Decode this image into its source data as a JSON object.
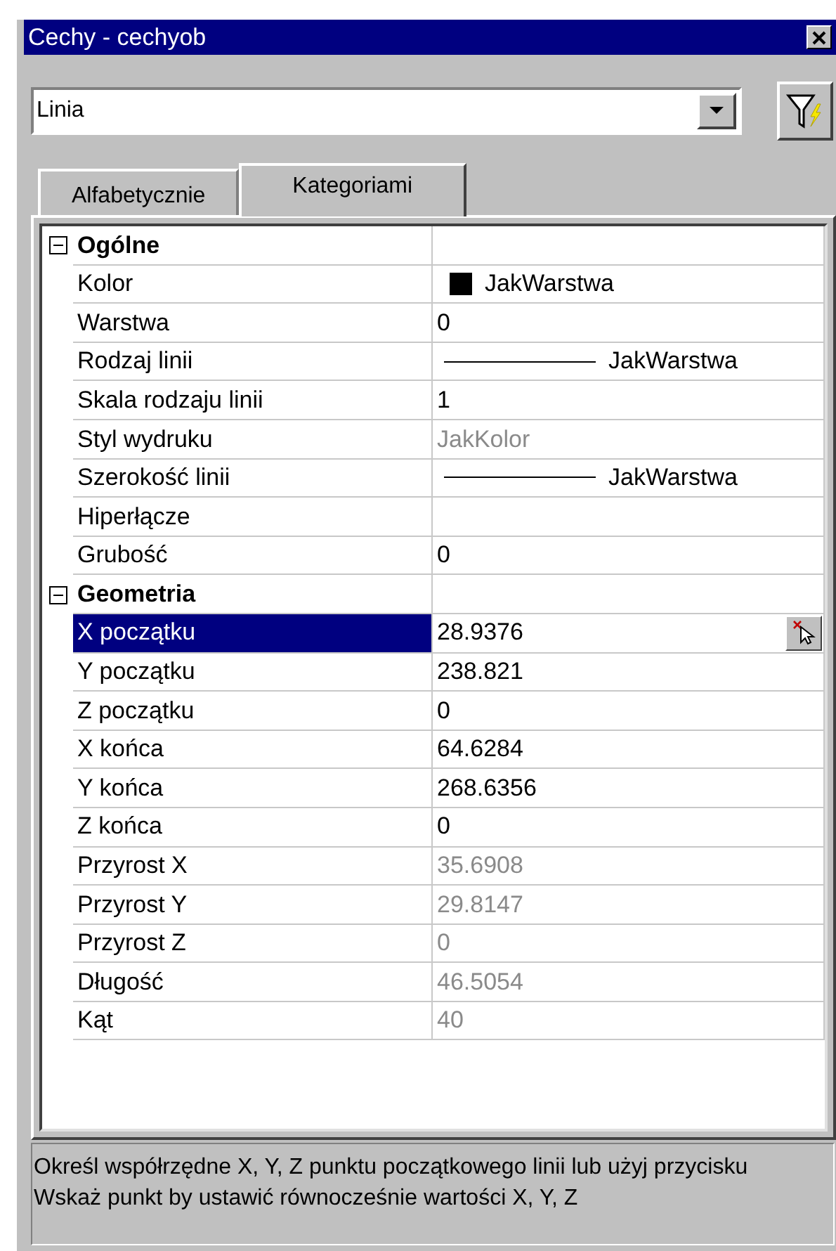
{
  "window": {
    "title": "Cechy - cechyob"
  },
  "object_selector": {
    "value": "Linia"
  },
  "tabs": [
    {
      "label": "Alfabetycznie",
      "selected": false
    },
    {
      "label": "Kategoriami",
      "selected": true
    }
  ],
  "categories": [
    {
      "name": "Ogólne",
      "expanded": true,
      "properties": [
        {
          "name": "Kolor",
          "value": "JakWarstwa",
          "kind": "color",
          "color": "#000000",
          "disabled": false,
          "selected": false
        },
        {
          "name": "Warstwa",
          "value": "0",
          "kind": "text",
          "disabled": false,
          "selected": false
        },
        {
          "name": "Rodzaj linii",
          "value": "JakWarstwa",
          "kind": "line",
          "disabled": false,
          "selected": false
        },
        {
          "name": "Skala rodzaju linii",
          "value": "1",
          "kind": "text",
          "disabled": false,
          "selected": false
        },
        {
          "name": "Styl wydruku",
          "value": "JakKolor",
          "kind": "text",
          "disabled": true,
          "selected": false
        },
        {
          "name": "Szerokość linii",
          "value": "JakWarstwa",
          "kind": "line",
          "disabled": false,
          "selected": false
        },
        {
          "name": "Hiperłącze",
          "kind": "text",
          "selected": false
        },
        {
          "name": "Grubość",
          "value": "0",
          "kind": "text",
          "disabled": false,
          "selected": false
        }
      ]
    },
    {
      "name": "Geometria",
      "expanded": true,
      "properties": [
        {
          "name": "X początku",
          "value": "28.9376",
          "kind": "point",
          "disabled": false,
          "selected": true
        },
        {
          "name": "Y początku",
          "value": "238.821",
          "kind": "text",
          "disabled": false,
          "selected": false
        },
        {
          "name": "Z początku",
          "value": "0",
          "kind": "text",
          "disabled": false,
          "selected": false
        },
        {
          "name": "X końca",
          "value": "64.6284",
          "kind": "text",
          "disabled": false,
          "selected": false
        },
        {
          "name": "Y końca",
          "value": "268.6356",
          "kind": "text",
          "disabled": false,
          "selected": false
        },
        {
          "name": "Z końca",
          "value": "0",
          "kind": "text",
          "disabled": false,
          "selected": false
        },
        {
          "name": "Przyrost X",
          "value": "35.6908",
          "kind": "text",
          "disabled": true,
          "selected": false
        },
        {
          "name": "Przyrost Y",
          "value": "29.8147",
          "kind": "text",
          "disabled": true,
          "selected": false
        },
        {
          "name": "Przyrost Z",
          "value": "0",
          "kind": "text",
          "disabled": true,
          "selected": false
        },
        {
          "name": "Długość",
          "value": "46.5054",
          "kind": "text",
          "disabled": true,
          "selected": false
        },
        {
          "name": "Kąt",
          "value": "40",
          "kind": "text",
          "disabled": true,
          "selected": false
        }
      ]
    }
  ],
  "description": "Określ współrzędne X, Y, Z punktu początkowego linii lub użyj przycisku Wskaż punkt by ustawić równocześnie wartości X, Y, Z"
}
